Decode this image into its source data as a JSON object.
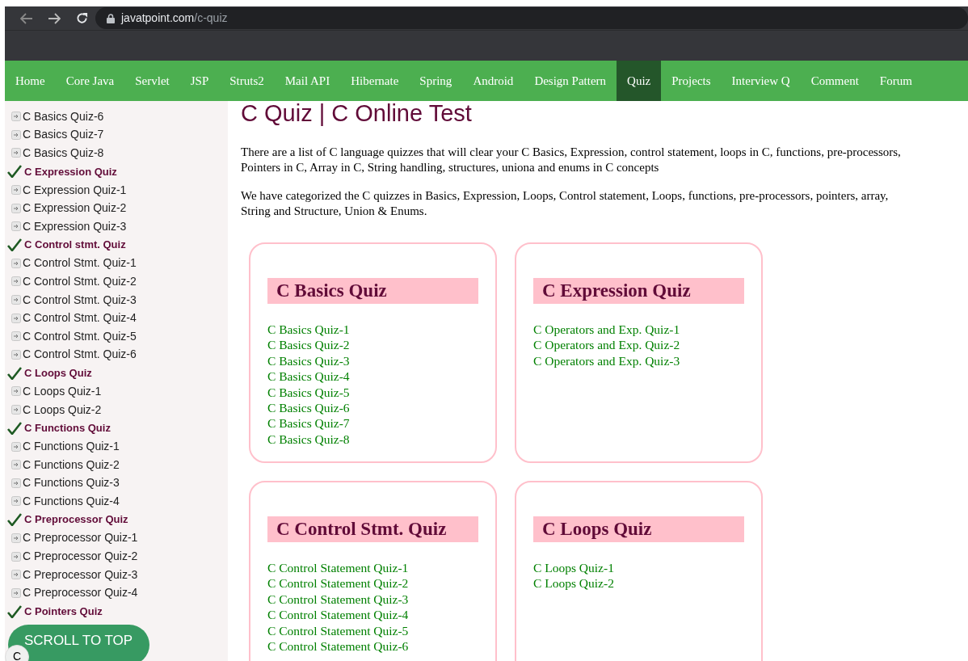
{
  "browser": {
    "url_host": "javatpoint.com",
    "url_path": "/c-quiz"
  },
  "nav": [
    {
      "label": "Home",
      "selected": false
    },
    {
      "label": "Core Java",
      "selected": false
    },
    {
      "label": "Servlet",
      "selected": false
    },
    {
      "label": "JSP",
      "selected": false
    },
    {
      "label": "Struts2",
      "selected": false
    },
    {
      "label": "Mail API",
      "selected": false
    },
    {
      "label": "Hibernate",
      "selected": false
    },
    {
      "label": "Spring",
      "selected": false
    },
    {
      "label": "Android",
      "selected": false
    },
    {
      "label": "Design Pattern",
      "selected": false
    },
    {
      "label": "Quiz",
      "selected": true
    },
    {
      "label": "Projects",
      "selected": false
    },
    {
      "label": "Interview Q",
      "selected": false
    },
    {
      "label": "Comment",
      "selected": false
    },
    {
      "label": "Forum",
      "selected": false
    }
  ],
  "sidebar": [
    {
      "kind": "link",
      "label": "C Basics Quiz-6"
    },
    {
      "kind": "link",
      "label": "C Basics Quiz-7"
    },
    {
      "kind": "link",
      "label": "C Basics Quiz-8"
    },
    {
      "kind": "heading",
      "label": "C Expression Quiz"
    },
    {
      "kind": "link",
      "label": "C Expression Quiz-1"
    },
    {
      "kind": "link",
      "label": "C Expression Quiz-2"
    },
    {
      "kind": "link",
      "label": "C Expression Quiz-3"
    },
    {
      "kind": "heading",
      "label": "C Control stmt. Quiz"
    },
    {
      "kind": "link",
      "label": "C Control Stmt. Quiz-1"
    },
    {
      "kind": "link",
      "label": "C Control Stmt. Quiz-2"
    },
    {
      "kind": "link",
      "label": "C Control Stmt. Quiz-3"
    },
    {
      "kind": "link",
      "label": "C Control Stmt. Quiz-4"
    },
    {
      "kind": "link",
      "label": "C Control Stmt. Quiz-5"
    },
    {
      "kind": "link",
      "label": "C Control Stmt. Quiz-6"
    },
    {
      "kind": "heading",
      "label": "C Loops Quiz"
    },
    {
      "kind": "link",
      "label": "C Loops Quiz-1"
    },
    {
      "kind": "link",
      "label": "C Loops Quiz-2"
    },
    {
      "kind": "heading",
      "label": "C Functions Quiz"
    },
    {
      "kind": "link",
      "label": "C Functions Quiz-1"
    },
    {
      "kind": "link",
      "label": "C Functions Quiz-2"
    },
    {
      "kind": "link",
      "label": "C Functions Quiz-3"
    },
    {
      "kind": "link",
      "label": "C Functions Quiz-4"
    },
    {
      "kind": "heading",
      "label": "C Preprocessor Quiz"
    },
    {
      "kind": "link",
      "label": "C Preprocessor Quiz-1"
    },
    {
      "kind": "link",
      "label": "C Preprocessor Quiz-2"
    },
    {
      "kind": "link",
      "label": "C Preprocessor Quiz-3"
    },
    {
      "kind": "link",
      "label": "C Preprocessor Quiz-4"
    },
    {
      "kind": "heading",
      "label": "C Pointers Quiz"
    }
  ],
  "title": "C Quiz | C Online Test",
  "paragraphs": [
    "There are a list of C language quizzes that will clear your C Basics, Expression, control statement, loops in C, functions, pre-processors, Pointers in C, Array in C, String handling, structures, uniona and enums in C concepts",
    "We have categorized the C quizzes in Basics, Expression, Loops, Control statement, Loops, functions, pre-processors, pointers, array, String and Structure, Union & Enums."
  ],
  "cards": [
    {
      "title": "C Basics Quiz",
      "links": [
        "C Basics Quiz-1",
        "C Basics Quiz-2",
        "C Basics Quiz-3",
        "C Basics Quiz-4",
        "C Basics Quiz-5",
        "C Basics Quiz-6",
        "C Basics Quiz-7",
        "C Basics Quiz-8"
      ]
    },
    {
      "title": "C Expression Quiz",
      "links": [
        "C Operators and Exp. Quiz-1",
        "C Operators and Exp. Quiz-2",
        "C Operators and Exp. Quiz-3"
      ]
    },
    {
      "title": "C Control Stmt. Quiz",
      "links": [
        "C Control Statement Quiz-1",
        "C Control Statement Quiz-2",
        "C Control Statement Quiz-3",
        "C Control Statement Quiz-4",
        "C Control Statement Quiz-5",
        "C Control Statement Quiz-6"
      ]
    },
    {
      "title": "C Loops Quiz",
      "links": [
        "C Loops Quiz-1",
        "C Loops Quiz-2"
      ]
    }
  ],
  "scroll_to_top": "SCROLL TO TOP",
  "corner_badge": "C"
}
